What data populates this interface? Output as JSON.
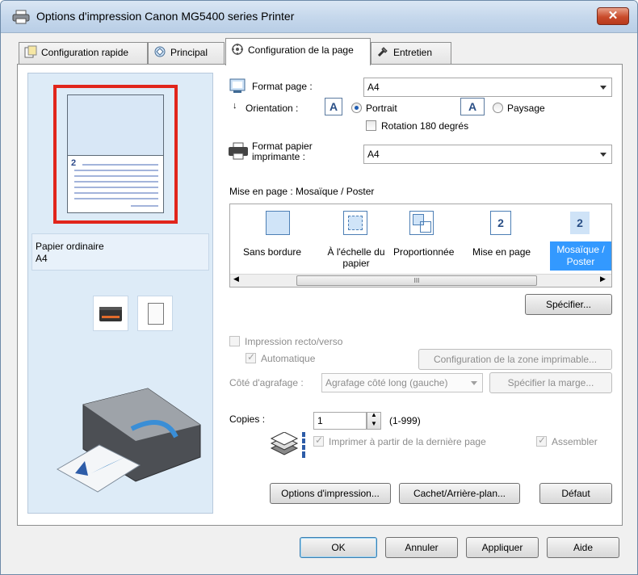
{
  "window": {
    "title": "Options d'impression Canon MG5400 series Printer",
    "close_label": "✕"
  },
  "tabs": [
    {
      "label": "Configuration rapide"
    },
    {
      "label": "Principal"
    },
    {
      "label": "Configuration de la page"
    },
    {
      "label": "Entretien"
    }
  ],
  "preview": {
    "page_number": "2",
    "media_type": "Papier ordinaire",
    "media_size": "A4"
  },
  "page_format": {
    "label": "Format page :",
    "value": "A4"
  },
  "orientation": {
    "label": "Orientation :",
    "icon_letter": "A",
    "portrait_label": "Portrait",
    "landscape_label": "Paysage",
    "rotate_label": "Rotation 180 degrés",
    "rotate_checked": false
  },
  "printer_paper": {
    "label_line1": "Format papier",
    "label_line2": "imprimante :",
    "value": "A4"
  },
  "layout": {
    "label": "Mise en page : Mosaïque / Poster",
    "items": [
      {
        "label": "Sans bordure"
      },
      {
        "label": "À l'échelle du papier"
      },
      {
        "label": "Proportionnée"
      },
      {
        "label": "Mise en page"
      },
      {
        "label": "Mosaïque / Poster"
      }
    ],
    "page_icon_number": "2",
    "scroll_thumb": "III",
    "specify_label": "Spécifier..."
  },
  "duplex": {
    "label": "Impression recto/verso",
    "auto_label": "Automatique",
    "area_button": "Configuration de la zone imprimable...",
    "staple_label": "Côté d'agrafage :",
    "staple_value": "Agrafage côté long (gauche)",
    "margin_button": "Spécifier la marge..."
  },
  "copies": {
    "label": "Copies :",
    "value": "1",
    "range": "(1-999)",
    "last_page_label": "Imprimer à partir de la dernière page",
    "collate_label": "Assembler"
  },
  "bottom_buttons": {
    "print_options": "Options d'impression...",
    "stamp_background": "Cachet/Arrière-plan...",
    "defaults": "Défaut"
  },
  "dialog_buttons": {
    "ok": "OK",
    "cancel": "Annuler",
    "apply": "Appliquer",
    "help": "Aide"
  },
  "colors": {
    "highlight_frame": "#e1251b",
    "selection": "#3399ff",
    "left_pane": "#ddebf7"
  }
}
